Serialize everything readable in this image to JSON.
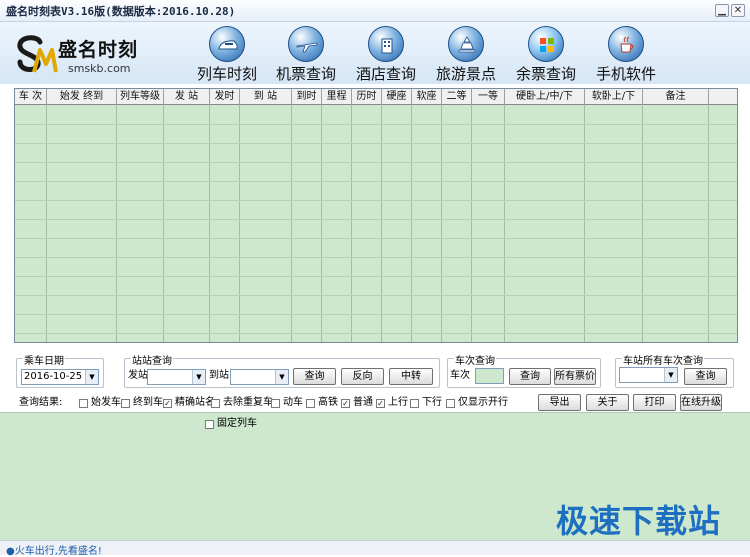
{
  "window": {
    "title": "盛名时刻表V3.16版(数据版本:2016.10.28)"
  },
  "brand": {
    "name": "盛名时刻",
    "url": "smskb.com",
    "mark": "SM"
  },
  "nav": [
    {
      "label": "列车时刻",
      "icon": "train-icon"
    },
    {
      "label": "机票查询",
      "icon": "plane-icon"
    },
    {
      "label": "酒店查询",
      "icon": "hotel-icon"
    },
    {
      "label": "旅游景点",
      "icon": "landmark-icon"
    },
    {
      "label": "余票查询",
      "icon": "windows-icon"
    },
    {
      "label": "手机软件",
      "icon": "java-cup-icon"
    }
  ],
  "grid": {
    "columns": [
      "车 次",
      "始发 终到",
      "列车等级",
      "发  站",
      "发时",
      "到  站",
      "到时",
      "里程",
      "历时",
      "硬座",
      "软座",
      "二等",
      "一等",
      "硬卧上/中/下",
      "软卧上/下",
      "备注"
    ],
    "rows": []
  },
  "date_group": {
    "title": "乘车日期",
    "value": "2016-10-25"
  },
  "station_group": {
    "title": "站站查询",
    "from_label": "发站",
    "to_label": "到站",
    "from_value": "",
    "to_value": "",
    "query_button": "查询",
    "reverse_button": "反向",
    "transfer_button": "中转"
  },
  "train_group": {
    "title": "车次查询",
    "train_label": "车次",
    "train_value": "",
    "query_button": "查询",
    "all_tickets_button": "所有票价"
  },
  "station_all_group": {
    "title": "车站所有车次查询",
    "value": "",
    "query_button": "查询"
  },
  "filters": {
    "label": "查询结果:",
    "items": [
      {
        "label": "始发车",
        "checked": false
      },
      {
        "label": "终到车",
        "checked": false
      },
      {
        "label": "精确站名",
        "checked": true
      },
      {
        "label": "去除重复车",
        "checked": false
      },
      {
        "label": "动车",
        "checked": false
      },
      {
        "label": "高铁",
        "checked": false
      },
      {
        "label": "普通",
        "checked": true
      },
      {
        "label": "上行",
        "checked": true
      },
      {
        "label": "下行",
        "checked": false
      },
      {
        "label": "仅显示开行",
        "checked": false
      }
    ],
    "fixed_train": {
      "label": "固定列车",
      "checked": false
    }
  },
  "actions": {
    "export": "导出",
    "about": "关于",
    "print": "打印",
    "upgrade": "在线升级"
  },
  "status": {
    "text": "●火车出行,先看盛名!"
  },
  "watermark": "极速下载站",
  "colors": {
    "grid_bg": "#cde8cd",
    "accent": "#1e6fc0",
    "header_bg": "#d5e6f5"
  }
}
